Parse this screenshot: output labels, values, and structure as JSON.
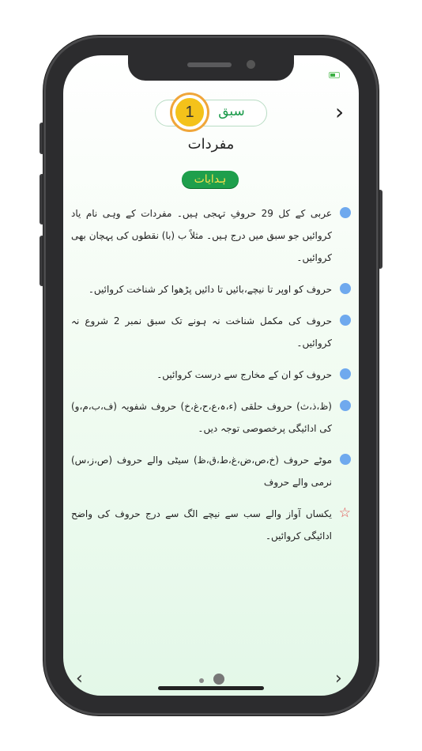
{
  "lesson": {
    "label": "سبق",
    "number": "1"
  },
  "heading": "مفردات",
  "instructions_badge": "ہدایات",
  "items": [
    {
      "text": "عربی کے کل 29 حروفِ تہجی ہیں۔ مفردات کے وہی نام یاد کروائیں جو سبق میں درج ہیں۔ مثلاً ب (با) نقطوں کی پہچان بھی کروائیں۔"
    },
    {
      "text": "حروف کو اوپر تا نیچے،بائیں تا دائیں پڑھوا کر شناخت کروائیں۔"
    },
    {
      "text": "حروف کی مکمل شناخت نہ ہونے تک سبق نمبر 2 شروع نہ کروائیں۔"
    },
    {
      "text": "حروف کو ان کے مخارج سے درست کروائیں۔"
    },
    {
      "text": "(ظ،ذ،ث) حروف حلقی (ء،ہ،ع،ح،غ،خ) حروف شفویہ (ف،ب،م،و) کی ادائیگی پرخصوصی توجہ دیں۔"
    },
    {
      "text": "موٹے حروف (خ،ص،ض،غ،ط،ق،ظ) سیٹی والے حروف (ص،ز،س) نرمی والے حروف"
    },
    {
      "text": "یکساں آواز والے سب سے نیچے الگ سے درج حروف کی واضح ادائیگی کروائیں۔"
    }
  ],
  "nav": {
    "next": "›",
    "prev_bottom": "‹",
    "next_bottom": "›"
  },
  "colors": {
    "accent_green": "#1e9f4c",
    "bullet_blue": "#6fa9ee",
    "star_red": "#e04a4a",
    "lesson_badge": "#f4c21a"
  },
  "icons": {
    "battery": "battery-icon",
    "star": "star-icon"
  }
}
